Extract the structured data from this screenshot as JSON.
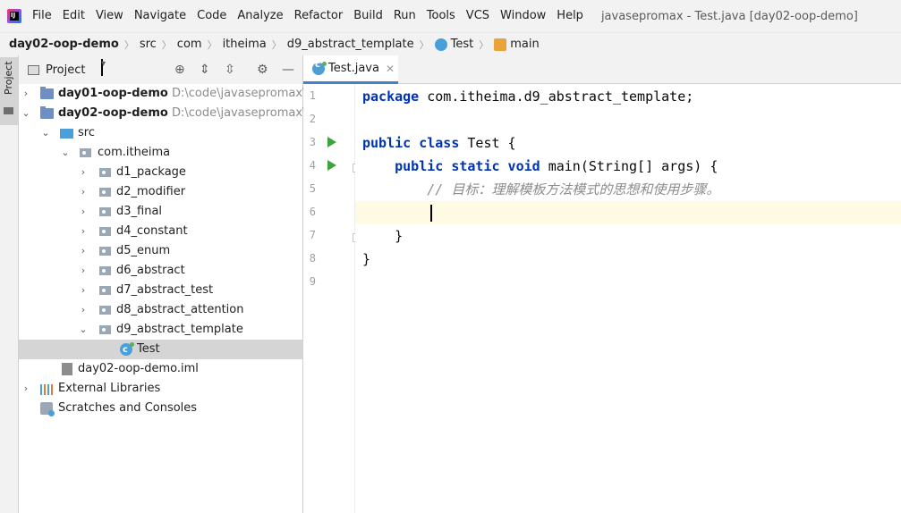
{
  "menubar": {
    "items": [
      "File",
      "Edit",
      "View",
      "Navigate",
      "Code",
      "Analyze",
      "Refactor",
      "Build",
      "Run",
      "Tools",
      "VCS",
      "Window",
      "Help"
    ],
    "window_title": "javasepromax - Test.java [day02-oop-demo]"
  },
  "breadcrumb": {
    "project": "day02-oop-demo",
    "items": [
      "src",
      "com",
      "itheima",
      "d9_abstract_template",
      "Test",
      "main"
    ]
  },
  "tool_stripe": {
    "project_tab": "Project"
  },
  "project_panel": {
    "title": "Project",
    "tree": [
      {
        "label": "day01-oop-demo",
        "hint": "D:\\code\\javasepromax\\",
        "type": "module"
      },
      {
        "label": "day02-oop-demo",
        "hint": "D:\\code\\javasepromax\\",
        "type": "module"
      },
      {
        "label": "src",
        "type": "srcfolder"
      },
      {
        "label": "com.itheima",
        "type": "package"
      },
      {
        "label": "d1_package",
        "type": "package"
      },
      {
        "label": "d2_modifier",
        "type": "package"
      },
      {
        "label": "d3_final",
        "type": "package"
      },
      {
        "label": "d4_constant",
        "type": "package"
      },
      {
        "label": "d5_enum",
        "type": "package"
      },
      {
        "label": "d6_abstract",
        "type": "package"
      },
      {
        "label": "d7_abstract_test",
        "type": "package"
      },
      {
        "label": "d8_abstract_attention",
        "type": "package"
      },
      {
        "label": "d9_abstract_template",
        "type": "package"
      },
      {
        "label": "Test",
        "type": "class"
      },
      {
        "label": "day02-oop-demo.iml",
        "type": "iml"
      },
      {
        "label": "External Libraries",
        "type": "libs"
      },
      {
        "label": "Scratches and Consoles",
        "type": "scratch"
      }
    ]
  },
  "editor": {
    "tab_label": "Test.java",
    "line_numbers": [
      "1",
      "2",
      "3",
      "4",
      "5",
      "6",
      "7",
      "8",
      "9"
    ],
    "code": {
      "l1_kw": "package",
      "l1_rest": " com.itheima.d9_abstract_template;",
      "l3_kw": "public class",
      "l3_rest": " Test {",
      "l4_kw": "public static void",
      "l4_rest": " main(String[] args) {",
      "l5_comment": "// 目标：理解模板方法模式的思想和使用步骤。",
      "l7": "    }",
      "l8": "}"
    }
  },
  "colors": {
    "keyword": "#0033b3",
    "comment": "#8c8c8c",
    "run_marker": "#3ea33e",
    "current_line": "#fffae3",
    "selection": "#d5d5d5"
  }
}
